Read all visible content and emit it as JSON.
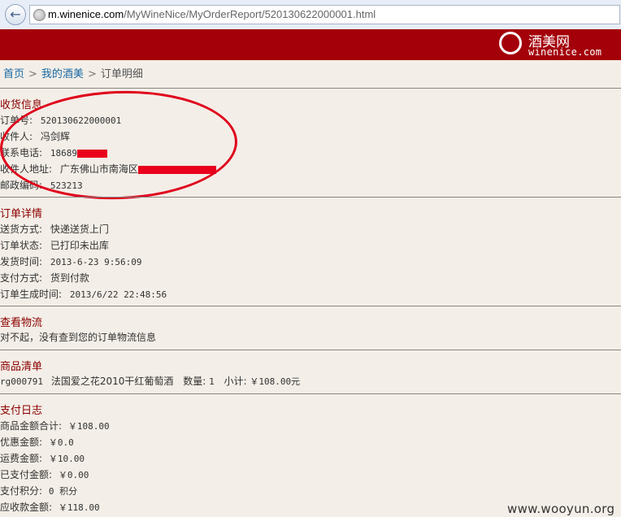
{
  "browser": {
    "url_host": "m.winenice.com",
    "url_path": "/MyWineNice/MyOrderReport/520130622000001.html"
  },
  "header": {
    "logo_cn": "酒美网",
    "logo_en": "winenice.com"
  },
  "breadcrumb": {
    "home": "首页",
    "my": "我的酒美",
    "current": "订单明细",
    "separator": ">"
  },
  "shipping": {
    "title": "收货信息",
    "order_no_label": "订单号:",
    "order_no": "520130622000001",
    "recipient_label": "收件人:",
    "recipient": "冯剑辉",
    "phone_label": "联系电话:",
    "phone": "18689",
    "address_label": "收件人地址:",
    "address": "广东佛山市南海区",
    "zip_label": "邮政编码:",
    "zip": "523213"
  },
  "order_detail": {
    "title": "订单详情",
    "delivery_label": "送货方式:",
    "delivery": "快递送货上门",
    "status_label": "订单状态:",
    "status": "已打印未出库",
    "ship_time_label": "发货时间:",
    "ship_time": "2013-6-23 9:56:09",
    "payment_label": "支付方式:",
    "payment": "货到付款",
    "created_label": "订单生成时间:",
    "created": "2013/6/22 22:48:56"
  },
  "logistics": {
    "title": "查看物流",
    "message": "对不起，没有查到您的订单物流信息"
  },
  "products": {
    "title": "商品清单",
    "items": [
      {
        "sku": "rg000791",
        "name": "法国爱之花2010干红葡萄酒",
        "qty_label": "数量:",
        "qty": "1",
        "subtotal_label": "小计:",
        "subtotal": "￥108.00元"
      }
    ]
  },
  "payment_log": {
    "title": "支付日志",
    "goods_total_label": "商品金额合计:",
    "goods_total": "￥108.00",
    "discount_label": "优惠金额:",
    "discount": "￥0.0",
    "shipping_fee_label": "运费金额:",
    "shipping_fee": "￥10.00",
    "paid_label": "已支付金额:",
    "paid": "￥0.00",
    "points_label": "支付积分:",
    "points": "0 积分",
    "due_label": "应收款金额:",
    "due": "￥118.00"
  },
  "watermark": "www.wooyun.org",
  "colors": {
    "header_bg": "#a4000a",
    "section_title": "#8b0000",
    "redaction": "#e8001c",
    "annotation_oval": "#e0001b",
    "page_bg": "#f3eee7"
  }
}
